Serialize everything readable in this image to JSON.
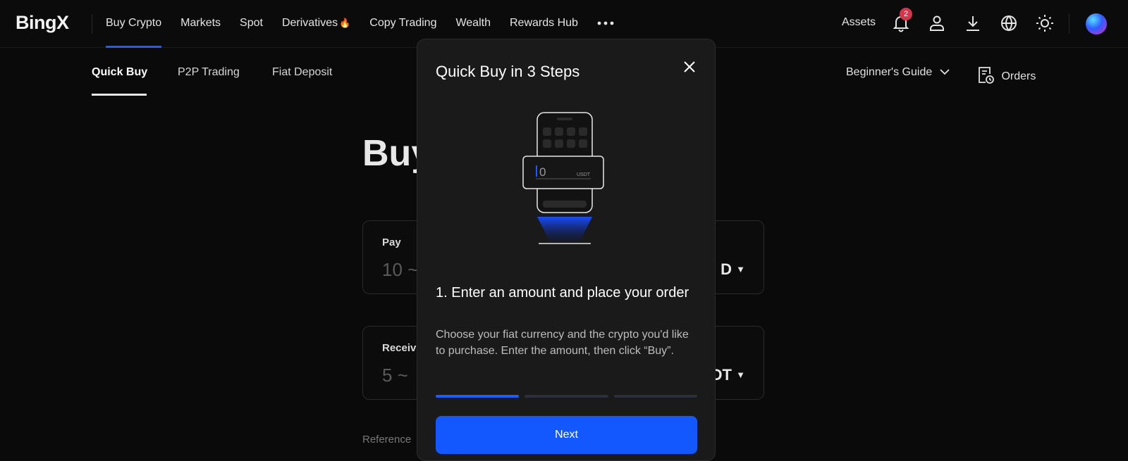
{
  "header": {
    "logo": "BingX",
    "nav": [
      {
        "label": "Buy Crypto",
        "active": true
      },
      {
        "label": "Markets"
      },
      {
        "label": "Spot"
      },
      {
        "label": "Derivatives",
        "icon": "fire-icon"
      },
      {
        "label": "Copy Trading"
      },
      {
        "label": "Wealth"
      },
      {
        "label": "Rewards Hub"
      }
    ],
    "more_icon": "more-dots-icon",
    "assets_label": "Assets",
    "notification_count": "2",
    "icons": [
      "bell-icon",
      "user-icon",
      "download-icon",
      "globe-icon",
      "sun-icon"
    ],
    "accent": "#1a5cff"
  },
  "subnav": {
    "items": [
      {
        "label": "Quick Buy",
        "active": true
      },
      {
        "label": "P2P Trading"
      },
      {
        "label": "Fiat Deposit"
      }
    ],
    "guide_label": "Beginner's Guide",
    "orders_label": "Orders"
  },
  "main": {
    "title_visible": "Buy",
    "pay": {
      "label": "Pay",
      "placeholder_visible": "10 ~",
      "currency_visible": "D"
    },
    "receive": {
      "label": "Receiv",
      "placeholder_visible": "5 ~",
      "currency_visible": "DT"
    },
    "reference_visible": "Reference"
  },
  "modal": {
    "title": "Quick Buy in 3 Steps",
    "illustration": {
      "amount": "0",
      "currency": "USDT"
    },
    "step_title": "1. Enter an amount and place your order",
    "step_desc": "Choose your fiat currency and the crypto you'd like to purchase. Enter the amount, then click “Buy”.",
    "step_current": 1,
    "step_total": 3,
    "next_label": "Next",
    "button_color": "#1358ff"
  }
}
